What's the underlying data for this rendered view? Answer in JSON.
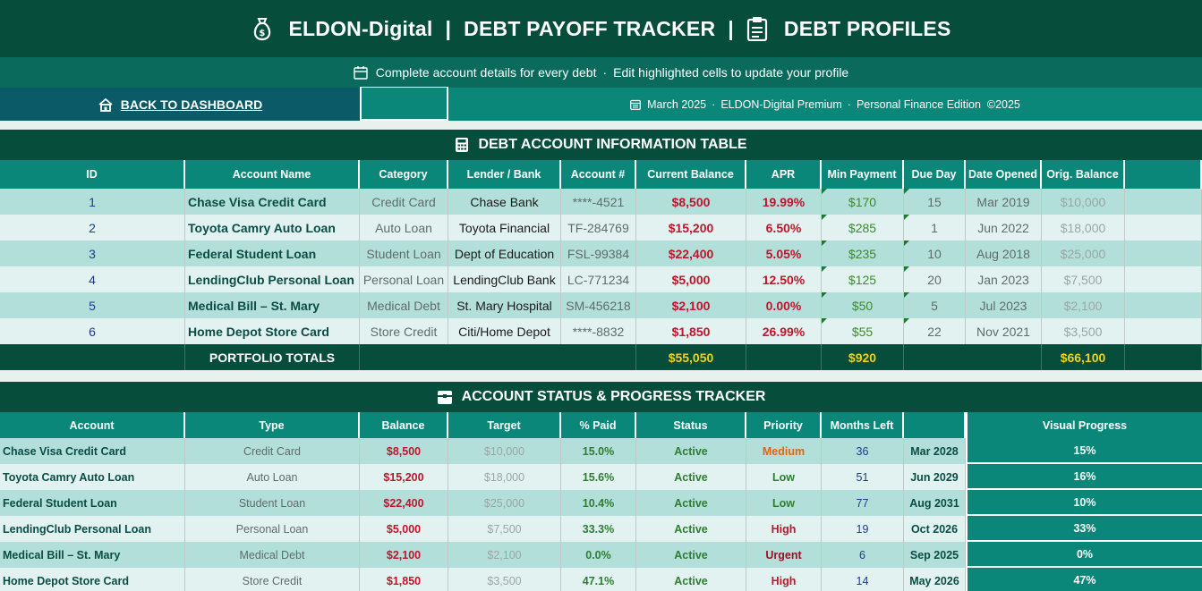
{
  "header": {
    "brand": "ELDON-Digital",
    "separator": "|",
    "tracker": "DEBT PAYOFF TRACKER",
    "page": "DEBT PROFILES",
    "icon_left": "money-bag-icon",
    "icon_right": "clipboard-icon"
  },
  "subtitle": {
    "part1": "Complete account details for every debt",
    "dot": "·",
    "part2": "Edit highlighted cells to update your profile",
    "icon": "calendar-icon"
  },
  "nav": {
    "back_label": "BACK TO DASHBOARD",
    "back_icon": "home-icon",
    "info": [
      "March 2025",
      "ELDON-Digital Premium",
      "Personal Finance Edition  ©2025"
    ],
    "info_icon": "calendar-icon"
  },
  "section1": {
    "title": "DEBT ACCOUNT INFORMATION TABLE",
    "icon": "calculator-icon",
    "columns": [
      "ID",
      "Account Name",
      "Category",
      "Lender / Bank",
      "Account #",
      "Current Balance",
      "APR",
      "Min Payment",
      "Due Day",
      "Date Opened",
      "Orig. Balance"
    ],
    "rows": [
      {
        "id": "1",
        "name": "Chase Visa Credit Card",
        "category": "Credit Card",
        "lender": "Chase Bank",
        "account": "****-4521",
        "balance": "$8,500",
        "apr": "19.99%",
        "min": "$170",
        "due": "15",
        "opened": "Mar 2019",
        "orig": "$10,000"
      },
      {
        "id": "2",
        "name": "Toyota Camry Auto Loan",
        "category": "Auto Loan",
        "lender": "Toyota Financial",
        "account": "TF-284769",
        "balance": "$15,200",
        "apr": "6.50%",
        "min": "$285",
        "due": "1",
        "opened": "Jun 2022",
        "orig": "$18,000"
      },
      {
        "id": "3",
        "name": "Federal Student Loan",
        "category": "Student Loan",
        "lender": "Dept of Education",
        "account": "FSL-99384",
        "balance": "$22,400",
        "apr": "5.05%",
        "min": "$235",
        "due": "10",
        "opened": "Aug 2018",
        "orig": "$25,000"
      },
      {
        "id": "4",
        "name": "LendingClub Personal Loan",
        "category": "Personal Loan",
        "lender": "LendingClub Bank",
        "account": "LC-771234",
        "balance": "$5,000",
        "apr": "12.50%",
        "min": "$125",
        "due": "20",
        "opened": "Jan 2023",
        "orig": "$7,500"
      },
      {
        "id": "5",
        "name": "Medical Bill – St. Mary",
        "category": "Medical Debt",
        "lender": "St. Mary Hospital",
        "account": "SM-456218",
        "balance": "$2,100",
        "apr": "0.00%",
        "min": "$50",
        "due": "5",
        "opened": "Jul 2023",
        "orig": "$2,100"
      },
      {
        "id": "6",
        "name": "Home Depot Store Card",
        "category": "Store Credit",
        "lender": "Citi/Home Depot",
        "account": "****-8832",
        "balance": "$1,850",
        "apr": "26.99%",
        "min": "$55",
        "due": "22",
        "opened": "Nov 2021",
        "orig": "$3,500"
      }
    ],
    "totals": {
      "label": "PORTFOLIO TOTALS",
      "balance": "$55,050",
      "min": "$920",
      "orig": "$66,100"
    }
  },
  "section2": {
    "title": "ACCOUNT STATUS & PROGRESS TRACKER",
    "icon": "briefcase-icon",
    "columns": [
      "Account",
      "Type",
      "Balance",
      "Target",
      "% Paid",
      "Status",
      "Priority",
      "Months Left",
      "",
      "Visual Progress"
    ],
    "rows": [
      {
        "account": "Chase Visa Credit Card",
        "type": "Credit Card",
        "balance": "$8,500",
        "target": "$10,000",
        "paid": "15.0%",
        "status": "Active",
        "priority": "Medium",
        "months": "36",
        "date": "Mar 2028",
        "bar": "15%",
        "progress": 0.15
      },
      {
        "account": "Toyota Camry Auto Loan",
        "type": "Auto Loan",
        "balance": "$15,200",
        "target": "$18,000",
        "paid": "15.6%",
        "status": "Active",
        "priority": "Low",
        "months": "51",
        "date": "Jun 2029",
        "bar": "16%",
        "progress": 0.16
      },
      {
        "account": "Federal Student Loan",
        "type": "Student Loan",
        "balance": "$22,400",
        "target": "$25,000",
        "paid": "10.4%",
        "status": "Active",
        "priority": "Low",
        "months": "77",
        "date": "Aug 2031",
        "bar": "10%",
        "progress": 0.1
      },
      {
        "account": "LendingClub Personal Loan",
        "type": "Personal Loan",
        "balance": "$5,000",
        "target": "$7,500",
        "paid": "33.3%",
        "status": "Active",
        "priority": "High",
        "months": "19",
        "date": "Oct 2026",
        "bar": "33%",
        "progress": 0.33
      },
      {
        "account": "Medical Bill – St. Mary",
        "type": "Medical Debt",
        "balance": "$2,100",
        "target": "$2,100",
        "paid": "0.0%",
        "status": "Active",
        "priority": "Urgent",
        "months": "6",
        "date": "Sep 2025",
        "bar": "0%",
        "progress": 0.0
      },
      {
        "account": "Home Depot Store Card",
        "type": "Store Credit",
        "balance": "$1,850",
        "target": "$3,500",
        "paid": "47.1%",
        "status": "Active",
        "priority": "High",
        "months": "14",
        "date": "May 2026",
        "bar": "47%",
        "progress": 0.47
      }
    ]
  },
  "colors": {
    "dark_green": "#064e3b",
    "teal": "#0b877a",
    "accent_red": "#c0152b",
    "accent_gold": "#f2d01b"
  }
}
